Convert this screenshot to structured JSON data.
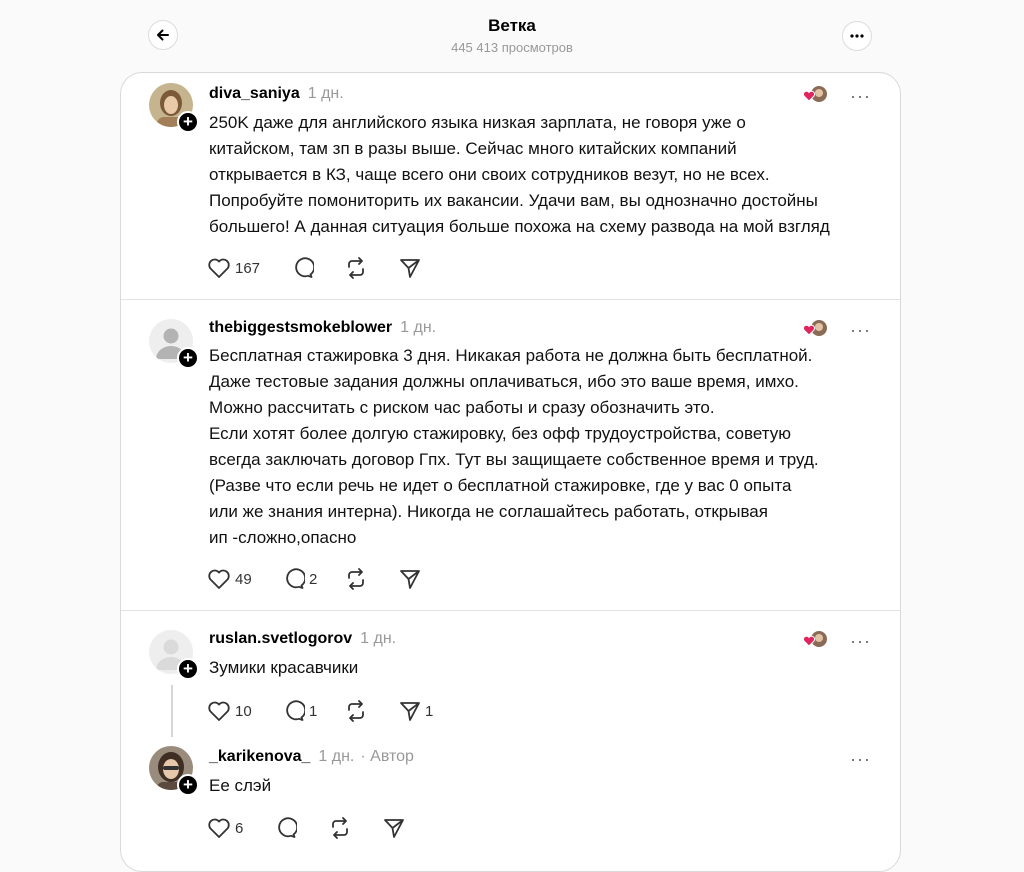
{
  "header": {
    "title": "Ветка",
    "views": "445 413 просмотров"
  },
  "posts": [
    {
      "username": "diva_saniya",
      "time": "1 дн.",
      "author_tag": "",
      "text": "250K даже для английского языка низкая зарплата, не говоря уже о\nкитайском, там зп в разы выше. Сейчас много китайских компаний\nоткрывается в КЗ, чаще всего они своих сотрудников везут, но не всех.\nПопробуйте помониторить их вакансии. Удачи вам, вы однозначно достойны\nбольшего! А данная ситуация больше похожа на схему развода на мой взгляд",
      "likes": "167",
      "replies": "",
      "reposts": "",
      "shares": ""
    },
    {
      "username": "thebiggestsmokeblower",
      "time": "1 дн.",
      "author_tag": "",
      "text": "Бесплатная стажировка 3 дня. Никакая работа не должна быть бесплатной.\nДаже тестовые задания должны оплачиваться, ибо это ваше время, имхо.\nМожно рассчитать с риском час работы и сразу обозначить это.\nЕсли хотят более долгую стажировку, без офф трудоустройства, советую\nвсегда заключать договор Гпх. Тут вы защищаете собственное время и труд.\n(Разве что если речь не идет о бесплатной стажировке, где у вас 0 опыта\nили же знания интерна). Никогда не соглашайтесь работать, открывая\nип -сложно,опасно",
      "likes": "49",
      "replies": "2",
      "reposts": "",
      "shares": ""
    },
    {
      "username": "ruslan.svetlogorov",
      "time": "1 дн.",
      "author_tag": "",
      "text": "Зумики красавчики",
      "likes": "10",
      "replies": "1",
      "reposts": "",
      "shares": "1"
    },
    {
      "username": "_karikenova_",
      "time": "1 дн.",
      "author_tag": "· Автор",
      "text": "Ее слэй",
      "likes": "6",
      "replies": "",
      "reposts": "",
      "shares": ""
    }
  ],
  "icons": {
    "back": "arrow-left-icon",
    "more": "more-horizontal-icon",
    "like": "heart-icon",
    "reply": "comment-icon",
    "repost": "repost-icon",
    "share": "send-icon"
  },
  "colors": {
    "background": "#fafafa",
    "card": "#ffffff",
    "muted": "#999999",
    "heart": "#e0245e"
  }
}
